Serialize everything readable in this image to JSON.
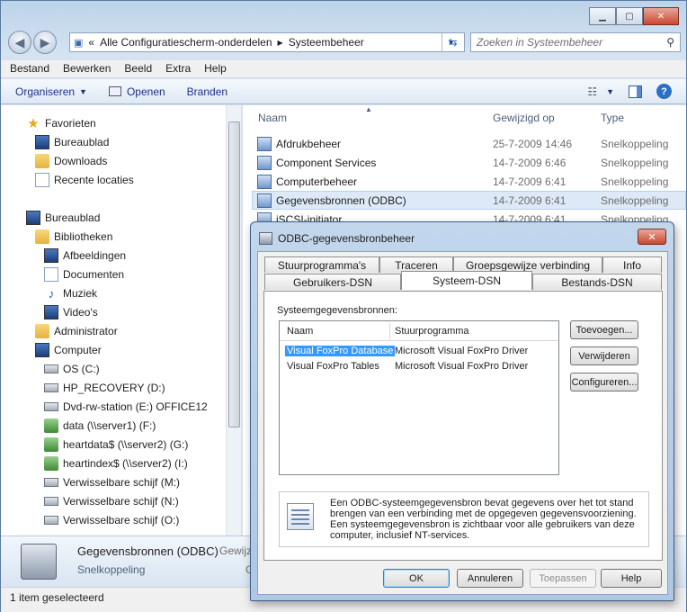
{
  "window": {
    "caption_buttons": [
      "minimize",
      "maximize",
      "close"
    ]
  },
  "address": {
    "chevron": "«",
    "crumbs": [
      "Alle Configuratiescherm-onderdelen",
      "Systeembeheer"
    ]
  },
  "search": {
    "placeholder": "Zoeken in Systeembeheer"
  },
  "menu": [
    "Bestand",
    "Bewerken",
    "Beeld",
    "Extra",
    "Help"
  ],
  "toolbar": {
    "organize": "Organiseren",
    "open": "Openen",
    "burn": "Branden"
  },
  "navpane": {
    "items": [
      {
        "label": "Favorieten",
        "icon": "star-icon"
      },
      {
        "label": "Bureaublad",
        "icon": "desktop-icon"
      },
      {
        "label": "Downloads",
        "icon": "folder-icon"
      },
      {
        "label": "Recente locaties",
        "icon": "recent-icon"
      },
      {
        "label": "Bureaublad",
        "icon": "desktop-icon"
      },
      {
        "label": "Bibliotheken",
        "icon": "library-icon"
      },
      {
        "label": "Afbeeldingen",
        "icon": "pictures-icon"
      },
      {
        "label": "Documenten",
        "icon": "documents-icon"
      },
      {
        "label": "Muziek",
        "icon": "music-icon"
      },
      {
        "label": "Video's",
        "icon": "video-icon"
      },
      {
        "label": "Administrator",
        "icon": "user-folder-icon"
      },
      {
        "label": "Computer",
        "icon": "computer-icon"
      },
      {
        "label": "OS (C:)",
        "icon": "drive-icon"
      },
      {
        "label": "HP_RECOVERY (D:)",
        "icon": "drive-icon"
      },
      {
        "label": "Dvd-rw-station (E:) OFFICE12",
        "icon": "dvd-icon"
      },
      {
        "label": "data (\\\\server1) (F:)",
        "icon": "network-drive-icon"
      },
      {
        "label": "heartdata$ (\\\\server2) (G:)",
        "icon": "network-drive-icon"
      },
      {
        "label": "heartindex$ (\\\\server2) (I:)",
        "icon": "network-drive-icon"
      },
      {
        "label": "Verwisselbare schijf (M:)",
        "icon": "removable-drive-icon"
      },
      {
        "label": "Verwisselbare schijf (N:)",
        "icon": "removable-drive-icon"
      },
      {
        "label": "Verwisselbare schijf (O:)",
        "icon": "removable-drive-icon"
      }
    ]
  },
  "filelist": {
    "headers": {
      "name": "Naam",
      "modified": "Gewijzigd op",
      "type": "Type"
    },
    "rows": [
      {
        "name": "Afdrukbeheer",
        "date": "25-7-2009 14:46",
        "type": "Snelkoppeling"
      },
      {
        "name": "Component Services",
        "date": "14-7-2009 6:46",
        "type": "Snelkoppeling"
      },
      {
        "name": "Computerbeheer",
        "date": "14-7-2009 6:41",
        "type": "Snelkoppeling"
      },
      {
        "name": "Gegevensbronnen (ODBC)",
        "date": "14-7-2009 6:41",
        "type": "Snelkoppeling"
      },
      {
        "name": "iSCSI-initiator",
        "date": "14-7-2009 6:41",
        "type": "Snelkoppeling"
      }
    ]
  },
  "details": {
    "name": "Gegevensbronnen (ODBC)",
    "kind": "Snelkoppeling",
    "modified_label": "Gewijz",
    "g": "G"
  },
  "status": {
    "text": "1 item geselecteerd"
  },
  "dialog": {
    "title": "ODBC-gegevensbronbeheer",
    "tabs_row1": [
      "Stuurprogramma's",
      "Traceren",
      "Groepsgewijze verbinding",
      "Info"
    ],
    "tabs_row2": [
      "Gebruikers-DSN",
      "Systeem-DSN",
      "Bestands-DSN"
    ],
    "section_label": "Systeemgegevensbronnen:",
    "list_headers": {
      "name": "Naam",
      "driver": "Stuurprogramma"
    },
    "sources": [
      {
        "name": "Visual FoxPro Database",
        "driver": "Microsoft Visual FoxPro Driver",
        "selected": true
      },
      {
        "name": "Visual FoxPro Tables",
        "driver": "Microsoft Visual FoxPro Driver",
        "selected": false
      }
    ],
    "buttons": {
      "add": "Toevoegen...",
      "remove": "Verwijderen",
      "configure": "Configureren..."
    },
    "info_text": "Een ODBC-systeemgegevensbron bevat gegevens over het tot stand brengen van een verbinding met de opgegeven gegevensvoorziening. Een systeemgegevensbron is zichtbaar voor alle gebruikers van deze computer, inclusief NT-services.",
    "footer": {
      "ok": "OK",
      "cancel": "Annuleren",
      "apply": "Toepassen",
      "help": "Help"
    }
  }
}
